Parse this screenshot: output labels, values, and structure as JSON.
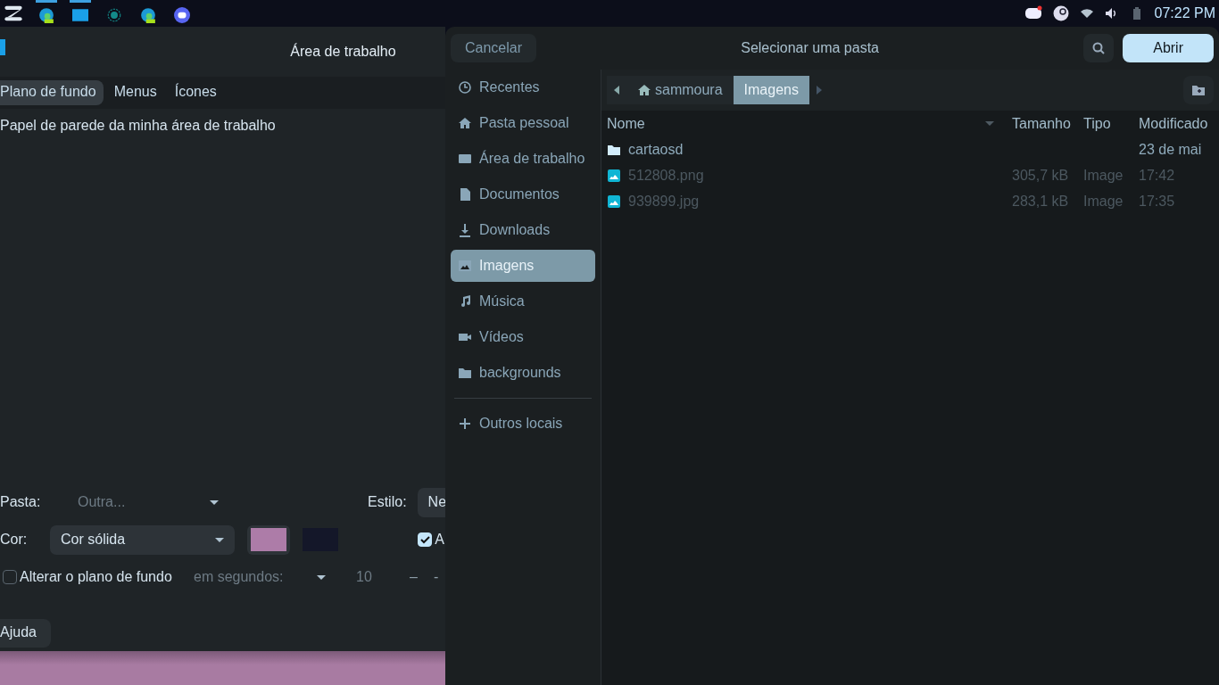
{
  "taskbar": {
    "apps": [
      {
        "kind": "browser",
        "active": true
      },
      {
        "kind": "window",
        "active": true
      },
      {
        "kind": "dot",
        "active": false
      },
      {
        "kind": "browser",
        "active": false
      },
      {
        "kind": "chat",
        "active": false
      }
    ],
    "clock": "07:22 PM"
  },
  "settings_window": {
    "title": "Área de trabalho",
    "tabs": [
      {
        "label": "Plano de fundo",
        "selected": true
      },
      {
        "label": "Menus",
        "selected": false
      },
      {
        "label": "Ícones",
        "selected": false
      }
    ],
    "heading": "Papel de parede da minha área de trabalho",
    "folder": {
      "label": "Pasta:",
      "value": "Outra...",
      "disabled": true
    },
    "style": {
      "label": "Estilo:",
      "value": "Ne"
    },
    "color": {
      "label": "Cor:",
      "value": "Cor sólida",
      "swatches": [
        {
          "color": "#ad7ca8"
        },
        {
          "color": "#141729"
        }
      ]
    },
    "color_checkbox": {
      "label": "A",
      "checked": true
    },
    "change": {
      "label": "Alterar o plano de fundo",
      "checked": false,
      "interval": "em segundos:",
      "value": "10",
      "buttons": [
        "–",
        "-"
      ]
    },
    "help_button": "Ajuda"
  },
  "dialog": {
    "cancel": "Cancelar",
    "title": "Selecionar uma pasta",
    "open": "Abrir",
    "places": [
      {
        "kind": "recent",
        "label": "Recentes",
        "selected": false
      },
      {
        "kind": "home",
        "label": "Pasta pessoal",
        "selected": false
      },
      {
        "kind": "desktop",
        "label": "Área de trabalho",
        "selected": false
      },
      {
        "kind": "document",
        "label": "Documentos",
        "selected": false
      },
      {
        "kind": "download",
        "label": "Downloads",
        "selected": false
      },
      {
        "kind": "image",
        "label": "Imagens",
        "selected": true
      },
      {
        "kind": "music",
        "label": "Música",
        "selected": false
      },
      {
        "kind": "video",
        "label": "Vídeos",
        "selected": false
      },
      {
        "kind": "folder",
        "label": "backgrounds",
        "selected": false
      }
    ],
    "other": "Outros locais",
    "path": [
      {
        "kind": "home",
        "label": "sammoura",
        "selected": false
      },
      {
        "kind": "folder",
        "label": "Imagens",
        "selected": true
      }
    ],
    "columns": [
      "Nome",
      "Tamanho",
      "Tipo",
      "Modificado"
    ],
    "files": [
      {
        "kind": "folder",
        "name": "cartaosd",
        "modified": "23 de mai",
        "disabled": false
      },
      {
        "kind": "image",
        "name": "512808.png",
        "size": "305,7 kB",
        "type": "Image",
        "modified": "17:42",
        "disabled": true
      },
      {
        "kind": "image",
        "name": "939899.jpg",
        "size": "283,1 kB",
        "type": "Image",
        "modified": "17:35",
        "disabled": true
      }
    ]
  }
}
